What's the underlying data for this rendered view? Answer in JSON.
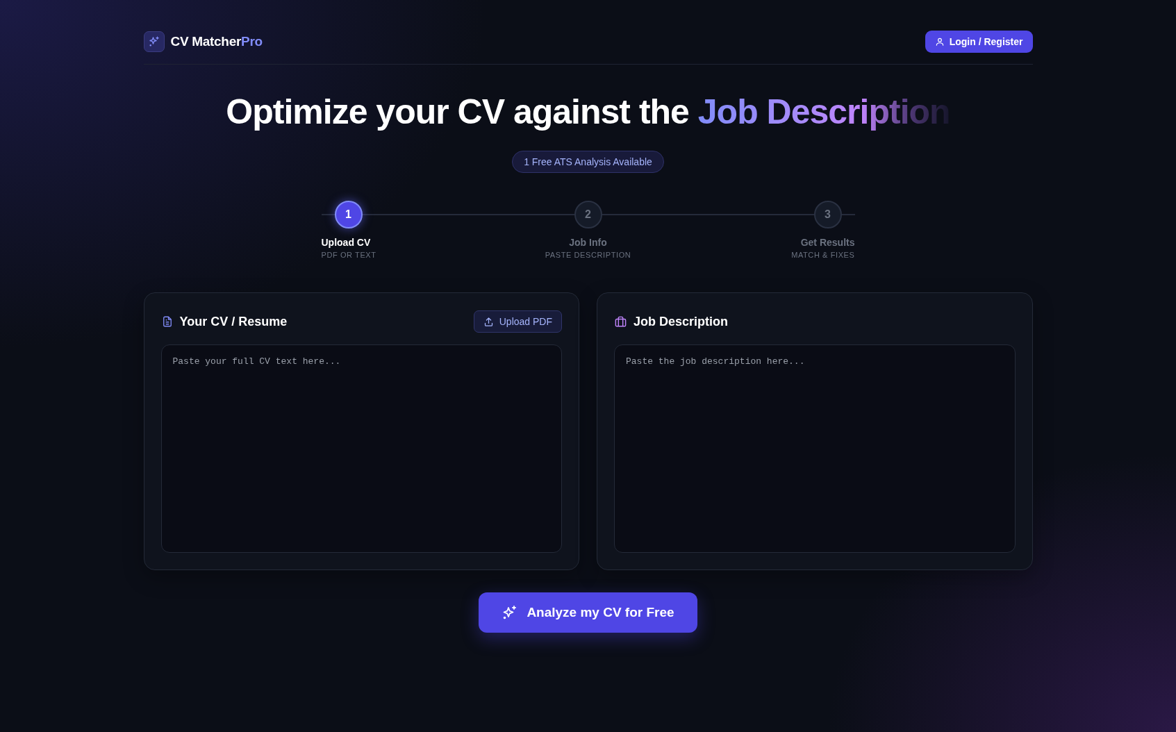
{
  "header": {
    "brand": "CV Matcher",
    "brand_accent": "Pro",
    "login": "Login / Register"
  },
  "hero": {
    "title": "Optimize your CV against the ",
    "title_accent": "Job Description",
    "badge": "1 Free ATS Analysis Available"
  },
  "steps": [
    {
      "number": "1",
      "label": "Upload CV",
      "sublabel": "PDF OR TEXT",
      "selected": true
    },
    {
      "number": "2",
      "label": "Job Info",
      "sublabel": "PASTE DESCRIPTION",
      "selected": false
    },
    {
      "number": "3",
      "label": "Get Results",
      "sublabel": "MATCH & FIXES",
      "selected": false
    }
  ],
  "panels": [
    {
      "kind": "cv",
      "title": "Your CV / Resume",
      "button": "Upload PDF",
      "placeholder": "Paste your full CV text here..."
    },
    {
      "kind": "job",
      "title": "Job Description",
      "placeholder": "Paste the job description here..."
    }
  ],
  "analyze_button": "Analyze my CV for Free"
}
